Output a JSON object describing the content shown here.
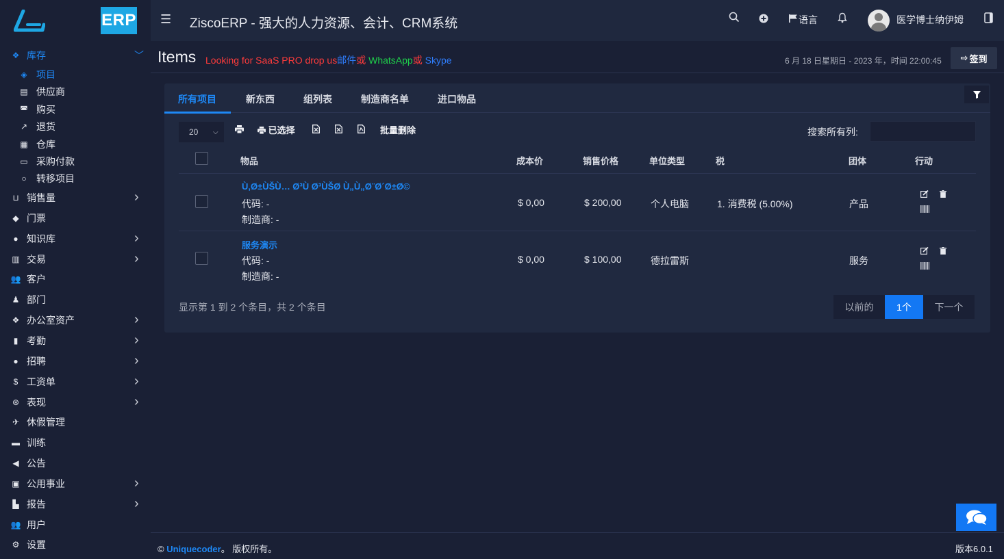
{
  "header": {
    "erp_badge": "ERP",
    "app_title": "ZiscoERP - 强大的人力资源、会计、CRM系统",
    "language": "语言",
    "username": "医学博士纳伊姆"
  },
  "sidebar": {
    "inventory": {
      "label": "库存",
      "icon": "cubes-icon"
    },
    "sub_items": [
      {
        "label": "项目",
        "icon": "cube-icon",
        "active": true
      },
      {
        "label": "供应商",
        "icon": "building-icon"
      },
      {
        "label": "购买",
        "icon": "shopping-bag-icon"
      },
      {
        "label": "退货",
        "icon": "share-square-icon"
      },
      {
        "label": "仓库",
        "icon": "warehouse-icon"
      },
      {
        "label": "采购付款",
        "icon": "credit-card-icon"
      },
      {
        "label": "转移项目",
        "icon": "circle-icon"
      }
    ],
    "items": [
      {
        "label": "销售量",
        "icon": "cart-icon",
        "has_children": true
      },
      {
        "label": "门票",
        "icon": "ticket-icon",
        "has_children": false
      },
      {
        "label": "知识库",
        "icon": "question-circle-icon",
        "has_children": true
      },
      {
        "label": "交易",
        "icon": "receipt-icon",
        "has_children": true
      },
      {
        "label": "客户",
        "icon": "users-icon",
        "has_children": false
      },
      {
        "label": "部门",
        "icon": "user-secret-icon",
        "has_children": false
      },
      {
        "label": "办公室资产",
        "icon": "cubes-icon",
        "has_children": true
      },
      {
        "label": "考勤",
        "icon": "file-icon",
        "has_children": true
      },
      {
        "label": "招聘",
        "icon": "globe-icon",
        "has_children": true
      },
      {
        "label": "工资单",
        "icon": "dollar-icon",
        "has_children": true
      },
      {
        "label": "表现",
        "icon": "dribbble-icon",
        "has_children": true
      },
      {
        "label": "休假管理",
        "icon": "plane-icon",
        "has_children": false
      },
      {
        "label": "训练",
        "icon": "briefcase-icon",
        "has_children": false
      },
      {
        "label": "公告",
        "icon": "bullhorn-icon",
        "has_children": false
      },
      {
        "label": "公用事业",
        "icon": "gift-icon",
        "has_children": true
      },
      {
        "label": "报告",
        "icon": "bar-chart-icon",
        "has_children": true
      },
      {
        "label": "用户",
        "icon": "users-icon",
        "has_children": false
      },
      {
        "label": "设置",
        "icon": "cogs-icon",
        "has_children": false
      }
    ]
  },
  "page": {
    "title": "Items",
    "promo": {
      "part1": "Looking for SaaS PRO drop us",
      "part2": "邮件",
      "part3": "或 ",
      "part4": "WhatsApp",
      "part5": "或 ",
      "part6": "Skype"
    },
    "datetime": "6 月 18 日星期日 - 2023 年，时间 22:00:45",
    "signin_label": "签到"
  },
  "tabs": [
    "所有项目",
    "新东西",
    "组列表",
    "制造商名单",
    "进口物品"
  ],
  "toolbar": {
    "page_size": "20",
    "selected_label": "已选择",
    "bulk_delete_label": "批量删除",
    "search_label": "搜索所有列:",
    "search_value": ""
  },
  "table": {
    "headers": [
      "物品",
      "成本价",
      "销售价格",
      "单位类型",
      "税",
      "团体",
      "行动"
    ],
    "rows": [
      {
        "name": "Ù‚Ø±ÙŠÙ… Ø³Ù Ø³ÙŠØ Ù„Ù„Ø¨Ø´Ø±Ø©",
        "code_label": "代码:",
        "code": "-",
        "mfr_label": "制造商:",
        "mfr": "-",
        "cost": "$ 0,00",
        "price": "$ 200,00",
        "unit": "个人电脑",
        "tax": "1. 消费税 (5.00%)",
        "group": "产品"
      },
      {
        "name": "服务演示",
        "code_label": "代码:",
        "code": "-",
        "mfr_label": "制造商:",
        "mfr": "-",
        "cost": "$ 0,00",
        "price": "$ 100,00",
        "unit": "德拉雷斯",
        "tax": "",
        "group": "服务"
      }
    ],
    "info": "显示第 1 到 2 个条目，共 2 个条目"
  },
  "pagination": {
    "prev": "以前的",
    "current": "1个",
    "next": "下一个"
  },
  "footer": {
    "copyright_prefix": "©",
    "brand": "Uniquecoder",
    "copyright_suffix": "。 版权所有。",
    "version": "版本6.0.1"
  },
  "colors": {
    "accent": "#1e88f5",
    "erp_badge": "#1ea7e4",
    "bg": "#1a2035",
    "card": "#202940"
  }
}
